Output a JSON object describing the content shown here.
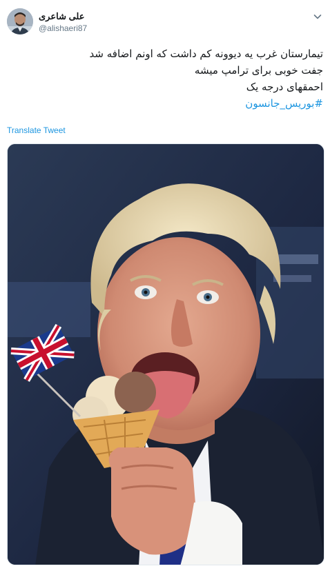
{
  "tweet": {
    "author": {
      "display_name": "علی شاعری",
      "handle": "@alishaeri87",
      "avatar_icon": "user-avatar-photo"
    },
    "text_lines": [
      "تیمارستان غرب یه دیوونه کم داشت که اونم اضافه شد",
      "جفت خوبی برای ترامپ میشه",
      "احمقهای درجه یک"
    ],
    "hashtag": "#بوریس_جانسون",
    "translate_label": "Translate Tweet",
    "menu_icon": "chevron-down-icon",
    "media": {
      "description_icon": "photo-man-eating-ice-cream-with-union-jack-flag"
    },
    "colors": {
      "link": "#1b95e0",
      "text": "#14171a",
      "secondary": "#657786"
    }
  }
}
